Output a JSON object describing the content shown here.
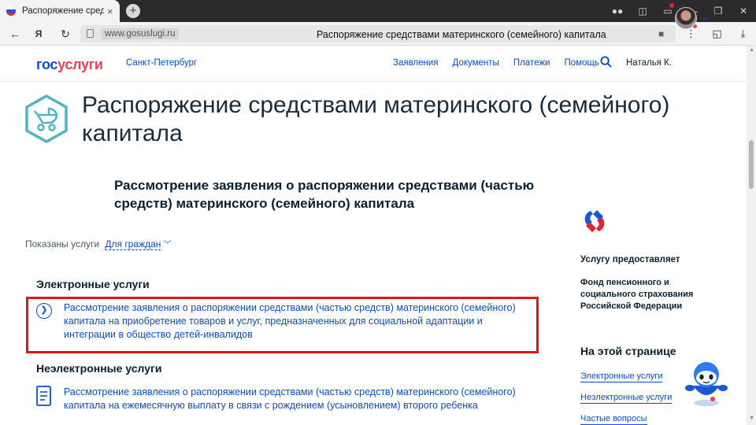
{
  "browser": {
    "tab_title": "Распоряжение средства",
    "tab_close": "×",
    "new_tab": "+",
    "url": "www.gosuslugi.ru",
    "address_title": "Распоряжение средствами материнского (семейного) капитала"
  },
  "header": {
    "logo_part1": "гос",
    "logo_part2": "услуги",
    "region": "Санкт-Петербург",
    "nav": [
      "Заявления",
      "Документы",
      "Платежи",
      "Помощь"
    ],
    "user_name": "Наталья К."
  },
  "main": {
    "title": "Распоряжение средствами материнского (семейного) капитала",
    "subtitle": "Рассмотрение заявления о распоряжении средствами (частью средств) материнского (семейного) капитала",
    "filter_label": "Показаны услуги",
    "filter_value": "Для граждан",
    "electronic_heading": "Электронные услуги",
    "electronic_service": "Рассмотрение заявления о распоряжении средствами (частью средств) материнского (семейного) капитала на приобретение товаров и услуг, предназначенных для социальной адаптации и интеграции в общество детей-инвалидов",
    "nonelectronic_heading": "Неэлектронные услуги",
    "nonelectronic_service": "Рассмотрение заявления о распоряжении средствами (частью средств) материнского (семейного) капитала на ежемесячную выплату в связи с рождением (усыновлением) второго ребенка"
  },
  "aside": {
    "provider_label": "Услугу предоставляет",
    "provider_name": "Фонд пенсионного и социального страхования Российской Федерации",
    "on_page_heading": "На этой странице",
    "anchors": [
      "Электронные услуги",
      "Неэлектронные услуги",
      "Частые вопросы"
    ]
  },
  "colors": {
    "accent": "#0d4cd3",
    "brand_red": "#ee3f58",
    "highlight": "#e0161b",
    "icon_teal": "#4eb5c1"
  },
  "icons": [
    "search-icon",
    "stroller-icon",
    "chevron-right-icon",
    "document-icon",
    "robot-assistant-icon",
    "sfr-logo"
  ]
}
